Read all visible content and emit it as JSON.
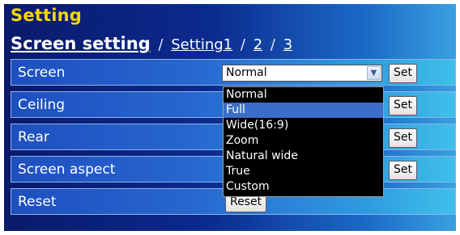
{
  "title": "Setting",
  "breadcrumb": {
    "current": "Screen setting",
    "sep": "/",
    "links": [
      "Setting1",
      "2",
      "3"
    ]
  },
  "rows": [
    {
      "label": "Screen",
      "control": "select",
      "value": "Normal",
      "button": "Set"
    },
    {
      "label": "Ceiling",
      "button": "Set"
    },
    {
      "label": "Rear",
      "button": "Set"
    },
    {
      "label": "Screen aspect",
      "button": "Set"
    },
    {
      "label": "Reset",
      "button": "Reset"
    }
  ],
  "dropdown": {
    "options": [
      "Normal",
      "Full",
      "Wide(16:9)",
      "Zoom",
      "Natural wide",
      "True",
      "Custom"
    ],
    "highlighted": "Full"
  },
  "colors": {
    "title": "#f5d800",
    "highlight": "#3a6ec8"
  },
  "icons": {
    "select_arrow": "chevron-down-icon"
  }
}
